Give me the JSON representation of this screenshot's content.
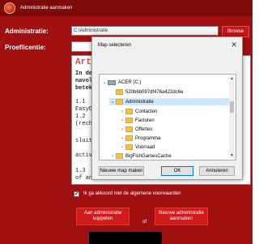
{
  "window": {
    "title": "Administratie aanmaken"
  },
  "form": {
    "admin_label": "Administratie:",
    "admin_value": "C:\\Administratie",
    "browse_label": "Browse",
    "licence_label": "Proeflicentie:"
  },
  "terms": {
    "heading": "Art",
    "lines": [
      "In dez",
      "navolg",
      "beteke",
      "1.1",
      "EasyOr",
      "1.2",
      "(recht",
      "sluit",
      "active",
      "1.3",
      "of and"
    ]
  },
  "agreement": {
    "checked_mark": "✔",
    "label": "Ik ga akkoord met de algemene voorwaarden"
  },
  "actions": {
    "link_label": "Aan administratie koppelen",
    "or_label": "of",
    "create_label": "Nieuwe administratie aanmaken"
  },
  "dialog": {
    "title": "Map selecteren",
    "close_glyph": "✕",
    "tree": [
      {
        "label": "ACER (C:)",
        "type": "drive",
        "arrow": "⌄"
      },
      {
        "label": "520b6b097df476a422dc6e",
        "type": "folder",
        "arrow": ""
      },
      {
        "label": "Administratie",
        "type": "folder",
        "arrow": "⌄",
        "selected": true
      },
      {
        "label": "Contacten",
        "type": "folder",
        "arrow": "›"
      },
      {
        "label": "Facturen",
        "type": "folder",
        "arrow": "›"
      },
      {
        "label": "Offertes",
        "type": "folder",
        "arrow": "›"
      },
      {
        "label": "Programma",
        "type": "folder",
        "arrow": "›"
      },
      {
        "label": "Voorraad",
        "type": "folder",
        "arrow": "›"
      },
      {
        "label": "BigFishGamesCache",
        "type": "folder",
        "arrow": "›"
      }
    ],
    "new_folder_label": "Nieuwe map maken",
    "ok_label": "OK",
    "cancel_label": "Annuleren"
  }
}
